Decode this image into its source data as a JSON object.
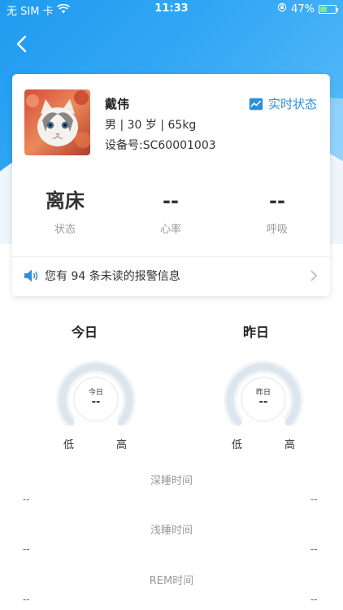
{
  "status_bar": {
    "carrier": "无 SIM 卡",
    "time": "11:33",
    "battery": "47%",
    "battery_level": 0.47
  },
  "profile": {
    "name": "戴伟",
    "meta": "男  | 30 岁 | 65kg",
    "device": "设备号:SC60001003",
    "realtime_label": "实时状态"
  },
  "stats": [
    {
      "value": "离床",
      "label": "状态"
    },
    {
      "value": "--",
      "label": "心率"
    },
    {
      "value": "--",
      "label": "呼吸"
    }
  ],
  "alert": {
    "text": "您有 94 条未读的报警信息"
  },
  "today": {
    "title": "今日",
    "gauge_label": "今日",
    "gauge_value": "--",
    "low": "低",
    "high": "高"
  },
  "yesterday": {
    "title": "昨日",
    "gauge_label": "昨日",
    "gauge_value": "--",
    "low": "低",
    "high": "高"
  },
  "sleep": [
    {
      "title": "深睡时间",
      "left": "--",
      "right": "--"
    },
    {
      "title": "浅睡时间",
      "left": "--",
      "right": "--"
    },
    {
      "title": "REM时间",
      "left": "--",
      "right": "--"
    }
  ],
  "colors": {
    "accent": "#2e8fd8",
    "header_blue": "#1e9bf0"
  }
}
